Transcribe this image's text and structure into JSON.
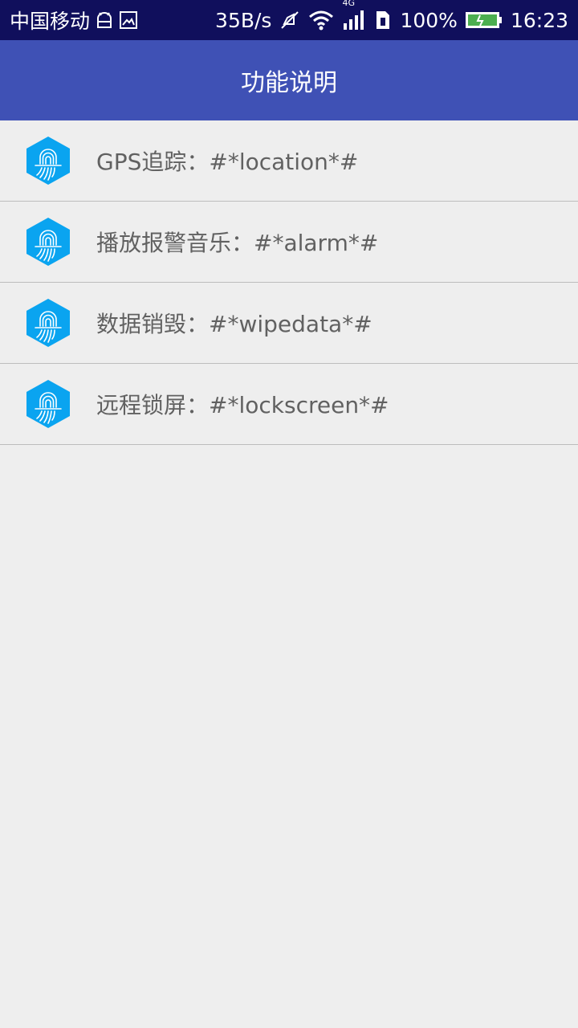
{
  "status_bar": {
    "carrier": "中国移动",
    "speed": "35B/s",
    "network": "4G",
    "battery": "100%",
    "time": "16:23"
  },
  "app_bar": {
    "title": "功能说明"
  },
  "items": [
    {
      "label": "GPS追踪：#*location*#",
      "icon": "fingerprint-hexagon-icon"
    },
    {
      "label": "播放报警音乐：#*alarm*#",
      "icon": "fingerprint-hexagon-icon"
    },
    {
      "label": "数据销毁：#*wipedata*#",
      "icon": "fingerprint-hexagon-icon"
    },
    {
      "label": "远程锁屏：#*lockscreen*#",
      "icon": "fingerprint-hexagon-icon"
    }
  ],
  "colors": {
    "status_bar": "#100f5c",
    "app_bar": "#3f51b5",
    "icon_blue": "#0aa4f0",
    "background": "#eeeeee"
  }
}
